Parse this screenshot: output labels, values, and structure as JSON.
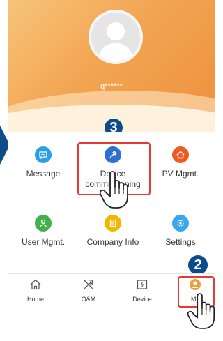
{
  "profile": {
    "username": "q******"
  },
  "grid": [
    {
      "label": "Message",
      "icon": "message-icon",
      "color": "#2a9ee6"
    },
    {
      "label": "Device commissioning",
      "icon": "device-commissioning-icon",
      "color": "#2f6fd0"
    },
    {
      "label": "PV Mgmt.",
      "icon": "home-icon",
      "color": "#ee5a24"
    },
    {
      "label": "User Mgmt.",
      "icon": "user-icon",
      "color": "#43b14b"
    },
    {
      "label": "Company Info",
      "icon": "company-icon",
      "color": "#f4b400"
    },
    {
      "label": "Settings",
      "icon": "settings-icon",
      "color": "#37a8f0"
    }
  ],
  "nav": [
    {
      "label": "Home",
      "icon": "home-icon"
    },
    {
      "label": "O&M",
      "icon": "tools-icon"
    },
    {
      "label": "Device",
      "icon": "device-icon"
    },
    {
      "label": "My",
      "icon": "my-icon",
      "active_color": "#f39c3e"
    }
  ],
  "steps": {
    "step3": "3",
    "step2": "2"
  }
}
